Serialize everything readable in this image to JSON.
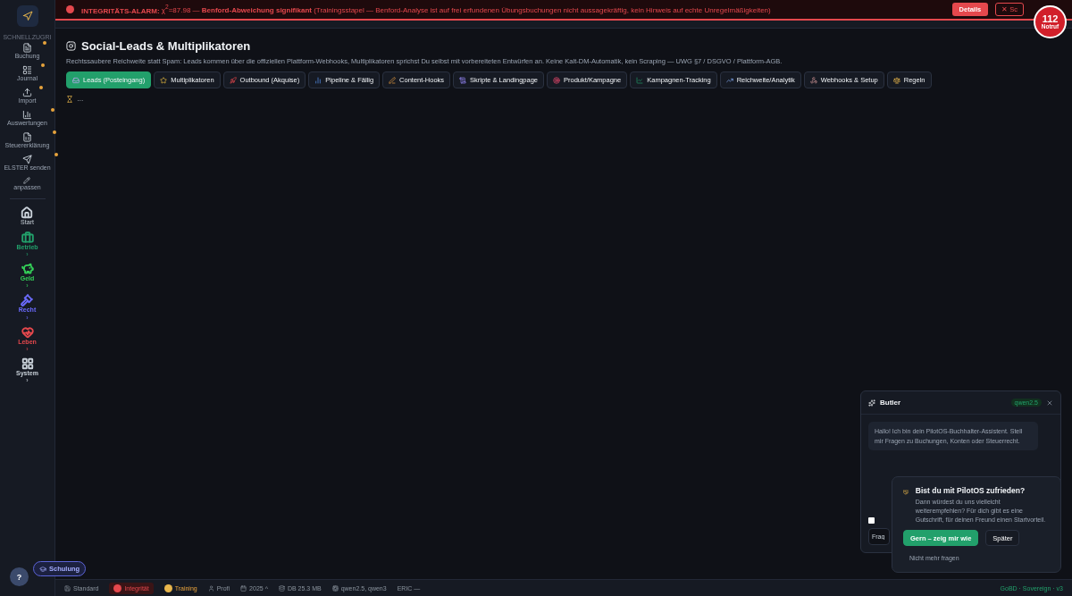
{
  "alarm": {
    "title": "INTEGRITÄTS-ALARM:",
    "formula": "χ$^{2}$=87.98 — **Benford-Abweichung signifikant** (Trainingsstapel — Benford-Analyse ist auf frei erfundenen Übungsbuchungen nicht aussagekräftig, kein Hinweis auf echte Unregelmäßigkeiten)",
    "details": "Details",
    "close": "✕ Sc"
  },
  "emergency": {
    "number": "112",
    "label": "Notruf"
  },
  "sidebar": {
    "section": "SCHNELLZUGRI",
    "quick": [
      {
        "label": "Buchung",
        "starred": true
      },
      {
        "label": "Journal",
        "starred": true
      },
      {
        "label": "Import",
        "starred": true
      },
      {
        "label": "Auswertungen",
        "starred": true
      },
      {
        "label": "Steuererklärung",
        "starred": true
      },
      {
        "label": "ELSTER senden",
        "starred": true
      }
    ],
    "customize": "anpassen",
    "nav": [
      {
        "label": "Start",
        "color": "#c9d1d9"
      },
      {
        "label": "Betrieb",
        "color": "#22a06b",
        "chevron": "›"
      },
      {
        "label": "Geld",
        "color": "#34d058",
        "chevron": "›"
      },
      {
        "label": "Recht",
        "color": "#6b6bff",
        "chevron": "›"
      },
      {
        "label": "Leben",
        "color": "#e5484d",
        "chevron": "›"
      },
      {
        "label": "System",
        "color": "#c9d1d9",
        "chevron": "›"
      }
    ]
  },
  "page": {
    "title": "Social-Leads & Multiplikatoren",
    "subtitle": "Rechtssaubere Reichweite statt Spam: Leads kommen über die offiziellen Plattform-Webhooks, Multiplikatoren sprichst Du selbst mit vorbereiteten Entwürfen an. Keine Kalt-DM-Automatik, kein Scraping — UWG §7 / DSGVO / Plattform-AGB.",
    "tabs": [
      {
        "label": "Leads (Posteingang)",
        "selected": true
      },
      {
        "label": "Multiplikatoren",
        "selected": false
      },
      {
        "label": "Outbound (Akquise)",
        "selected": false
      },
      {
        "label": "Pipeline & Fällig",
        "selected": false
      },
      {
        "label": "Content-Hooks",
        "selected": false
      },
      {
        "label": "Skripte & Landingpage",
        "selected": false
      },
      {
        "label": "Produkt/Kampagne",
        "selected": false
      },
      {
        "label": "Kampagnen-Tracking",
        "selected": false
      },
      {
        "label": "Reichweite/Analytik",
        "selected": false
      },
      {
        "label": "Webhooks & Setup",
        "selected": false
      },
      {
        "label": "Regeln",
        "selected": false
      }
    ],
    "loading": "…"
  },
  "butler": {
    "title": "Butler",
    "model": "qwen2.5",
    "message": "Hallo! Ich bin dein PilotOS-Buchhalter-Assistent. Stell mir Fragen zu Buchungen, Konten oder Steuerrecht.",
    "input": {
      "placeholder": "Frag"
    },
    "checkbox": {
      "checked": false
    }
  },
  "feedback": {
    "title": "Bist du mit PilotOS zufrieden?",
    "text": "Dann würdest du uns vielleicht weiterempfehlen? Für dich gibt es eine Gutschrift, für deinen Freund einen Startvorteil.",
    "accept": "Gern – zeig mir wie",
    "later": "Später",
    "never": "Nicht mehr fragen"
  },
  "help": "?",
  "training_button": "Schulung",
  "status_bar": [
    {
      "kind": "plain",
      "label": "Standard"
    },
    {
      "kind": "alert",
      "label": "Integrität"
    },
    {
      "kind": "warn",
      "label": "Training"
    },
    {
      "kind": "plain",
      "label": "Profi"
    },
    {
      "kind": "plain",
      "label": "2025 ^"
    },
    {
      "kind": "plain",
      "label": "DB 25.3 MB"
    },
    {
      "kind": "plain",
      "label": "qwen2.5, qwen3"
    },
    {
      "kind": "plain",
      "label": "ERIC —"
    }
  ],
  "version": "GoBD · Sovereign · v3"
}
